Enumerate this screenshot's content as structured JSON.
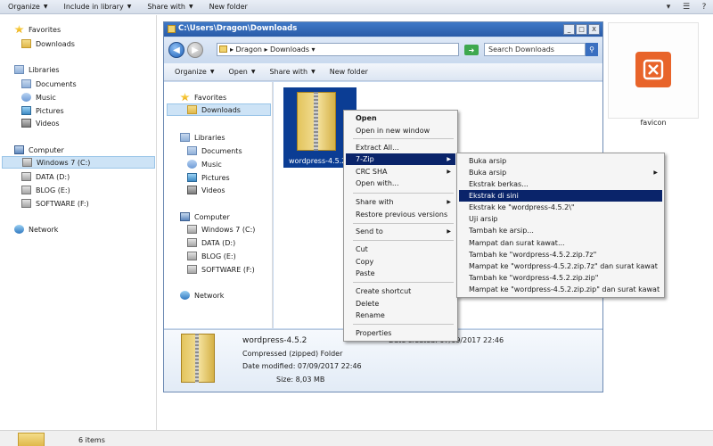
{
  "outer": {
    "toolbar": [
      {
        "label": "Organize",
        "dropdown": true
      },
      {
        "label": "Include in library",
        "dropdown": true
      },
      {
        "label": "Share with",
        "dropdown": true
      },
      {
        "label": "New folder",
        "dropdown": false
      }
    ],
    "window_controls": [
      "▾",
      "☰",
      "?"
    ],
    "nav": {
      "favorites": "Favorites",
      "downloads": "Downloads",
      "libraries": "Libraries",
      "documents": "Documents",
      "music": "Music",
      "pictures": "Pictures",
      "videos": "Videos",
      "computer": "Computer",
      "windows7": "Windows 7 (C:)",
      "data": "DATA (D:)",
      "blog": "BLOG (E:)",
      "software": "SOFTWARE (F:)",
      "network": "Network"
    },
    "favicon_label": "favicon",
    "status_count": "6 items"
  },
  "inner": {
    "title": "C:\\Users\\Dragon\\Downloads",
    "window_controls": [
      "_",
      "□",
      "X"
    ],
    "breadcrumb": "▸ Dragon ▸ Downloads ▾",
    "search_placeholder": "Search Downloads",
    "toolbar": [
      {
        "label": "Organize",
        "dropdown": true
      },
      {
        "label": "Open",
        "dropdown": true
      },
      {
        "label": "Share with",
        "dropdown": true
      },
      {
        "label": "New folder",
        "dropdown": false
      }
    ],
    "nav": {
      "favorites": "Favorites",
      "downloads": "Downloads",
      "libraries": "Libraries",
      "documents": "Documents",
      "music": "Music",
      "pictures": "Pictures",
      "videos": "Videos",
      "computer": "Computer",
      "windows7": "Windows 7 (C:)",
      "data": "DATA (D:)",
      "blog": "BLOG (E:)",
      "software": "SOFTWARE (F:)",
      "network": "Network"
    },
    "file_label": "wordpress-4.5.2",
    "details": {
      "name": "wordpress-4.5.2",
      "type": "Compressed (zipped) Folder",
      "modified": "Date modified: 07/09/2017 22:46",
      "created": "Date created: 07/09/2017 22:46",
      "size": "Size: 8,03 MB"
    }
  },
  "context_menu": {
    "items": [
      {
        "label": "Open",
        "bold": true,
        "submenu": false
      },
      {
        "label": "Open in new window",
        "submenu": false
      },
      {
        "label": "Extract All...",
        "submenu": false
      },
      {
        "label": "7-Zip",
        "submenu": true,
        "highlighted": true
      },
      {
        "label": "CRC SHA",
        "submenu": true
      },
      {
        "label": "Open with...",
        "submenu": false
      },
      {
        "label": "Share with",
        "submenu": true
      },
      {
        "label": "Restore previous versions",
        "submenu": false
      },
      {
        "label": "Send to",
        "submenu": true
      },
      {
        "label": "Cut",
        "submenu": false
      },
      {
        "label": "Copy",
        "submenu": false
      },
      {
        "label": "Paste",
        "submenu": false
      },
      {
        "label": "Create shortcut",
        "submenu": false
      },
      {
        "label": "Delete",
        "submenu": false
      },
      {
        "label": "Rename",
        "submenu": false
      },
      {
        "label": "Properties",
        "submenu": false
      }
    ]
  },
  "sub_menu": {
    "items": [
      {
        "label": "Buka arsip",
        "submenu": false
      },
      {
        "label": "Buka arsip",
        "submenu": true
      },
      {
        "label": "Ekstrak berkas...",
        "submenu": false
      },
      {
        "label": "Ekstrak di sini",
        "submenu": false,
        "highlighted": true
      },
      {
        "label": "Ekstrak ke \"wordpress-4.5.2\\\"",
        "submenu": false
      },
      {
        "label": "Uji arsip",
        "submenu": false
      },
      {
        "label": "Tambah ke arsip...",
        "submenu": false
      },
      {
        "label": "Mampat dan surat kawat...",
        "submenu": false
      },
      {
        "label": "Tambah ke \"wordpress-4.5.2.zip.7z\"",
        "submenu": false
      },
      {
        "label": "Mampat ke \"wordpress-4.5.2.zip.7z\" dan surat kawat",
        "submenu": false
      },
      {
        "label": "Tambah ke \"wordpress-4.5.2.zip.zip\"",
        "submenu": false
      },
      {
        "label": "Mampat ke \"wordpress-4.5.2.zip.zip\" dan surat kawat",
        "submenu": false
      }
    ]
  },
  "colors": {
    "highlight": "#0a246a",
    "titlebar": "#2a5ba8",
    "selection": "#0b3d94"
  }
}
